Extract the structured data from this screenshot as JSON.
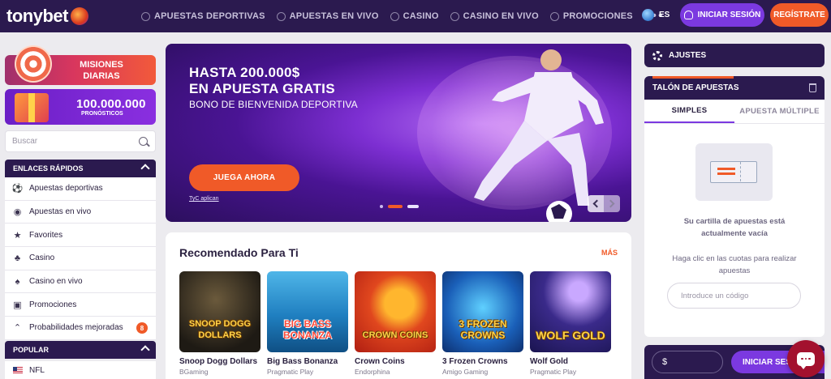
{
  "brand": {
    "logo_text": "tonybet"
  },
  "nav": {
    "items": [
      {
        "label": "APUESTAS DEPORTIVAS",
        "icon": "soccer-ball-icon"
      },
      {
        "label": "APUESTAS EN VIVO",
        "icon": "live-flame-icon"
      },
      {
        "label": "CASINO",
        "icon": "casino-chip-icon"
      },
      {
        "label": "CASINO EN VIVO",
        "icon": "live-casino-icon"
      },
      {
        "label": "PROMOCIONES",
        "icon": "gift-icon"
      }
    ],
    "more_label": "•••"
  },
  "header": {
    "language": "ES",
    "login_label": "INICIAR SESIÓN",
    "register_label": "REGÍSTRATE"
  },
  "sidebar": {
    "promo_missions": "MISIONES DIARIAS",
    "promo_predictions_amount": "100.000.000",
    "promo_predictions_label": "PRONÓSTICOS",
    "search_placeholder": "Buscar",
    "quick_links_title": "ENLACES RÁPIDOS",
    "quick_links": [
      {
        "label": "Apuestas deportivas",
        "icon": "soccer-ball-icon"
      },
      {
        "label": "Apuestas en vivo",
        "icon": "live-signal-icon"
      },
      {
        "label": "Favorites",
        "icon": "star-icon"
      },
      {
        "label": "Casino",
        "icon": "cherries-icon"
      },
      {
        "label": "Casino en vivo",
        "icon": "live-casino-icon"
      },
      {
        "label": "Promociones",
        "icon": "gift-icon"
      },
      {
        "label": "Probabilidades mejoradas",
        "icon": "boost-chevrons-icon",
        "badge": "8"
      }
    ],
    "popular_title": "POPULAR",
    "popular_items": [
      {
        "label": "NFL",
        "icon": "us-flag-icon"
      }
    ]
  },
  "hero": {
    "headline_line1": "HASTA 200.000$",
    "headline_line2": "EN APUESTA GRATIS",
    "subtitle": "BONO DE BIENVENIDA DEPORTIVA",
    "cta_label": "JUEGA AHORA",
    "terms_label": "TyC aplican"
  },
  "recommended": {
    "title": "Recomendado Para Ti",
    "more_label": "MÁS",
    "games": [
      {
        "name": "Snoop Dogg Dollars",
        "provider": "BGaming",
        "thumb_title": "SNOOP DOGG DOLLARS"
      },
      {
        "name": "Big Bass Bonanza",
        "provider": "Pragmatic Play",
        "thumb_title": "BIG BASS BONANZA"
      },
      {
        "name": "Crown Coins",
        "provider": "Endorphina",
        "thumb_title": "CROWN COINS"
      },
      {
        "name": "3 Frozen Crowns",
        "provider": "Amigo Gaming",
        "thumb_title": "3 FROZEN CROWNS"
      },
      {
        "name": "Wolf Gold",
        "provider": "Pragmatic Play",
        "thumb_title": "WOLF GOLD"
      }
    ]
  },
  "betslip": {
    "settings_label": "AJUSTES",
    "title": "TALÓN DE APUESTAS",
    "tab_single": "SIMPLES",
    "tab_multiple": "APUESTA MÚLTIPLE",
    "empty_title": "Su cartilla de apuestas está actualmente vacía",
    "empty_hint": "Haga clic en las cuotas para realizar apuestas",
    "code_placeholder": "Introduce un código",
    "currency_symbol": "$",
    "submit_label": "INICIAR SESIÓN"
  },
  "colors": {
    "primary_dark": "#2b1a4f",
    "accent_orange": "#f05a28",
    "accent_purple": "#7b39e0"
  }
}
